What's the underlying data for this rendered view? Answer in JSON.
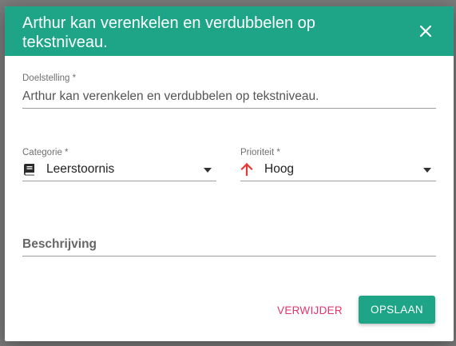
{
  "dialog": {
    "title": "Arthur kan verenkelen en verdubbelen op tekstniveau.",
    "close_icon": "close-icon"
  },
  "form": {
    "goal": {
      "label": "Doelstelling *",
      "value": "Arthur kan verenkelen en verdubbelen op tekstniveau."
    },
    "category": {
      "label": "Categorie *",
      "value": "Leerstoornis",
      "icon": "book-icon"
    },
    "priority": {
      "label": "Prioriteit *",
      "value": "Hoog",
      "icon": "arrow-up-icon",
      "icon_color": "#e53935"
    },
    "description": {
      "label": "Beschrijving"
    }
  },
  "actions": {
    "delete_label": "VERWIJDER",
    "save_label": "OPSLAAN"
  },
  "colors": {
    "accent": "#1ea588",
    "danger": "#e8336a"
  }
}
